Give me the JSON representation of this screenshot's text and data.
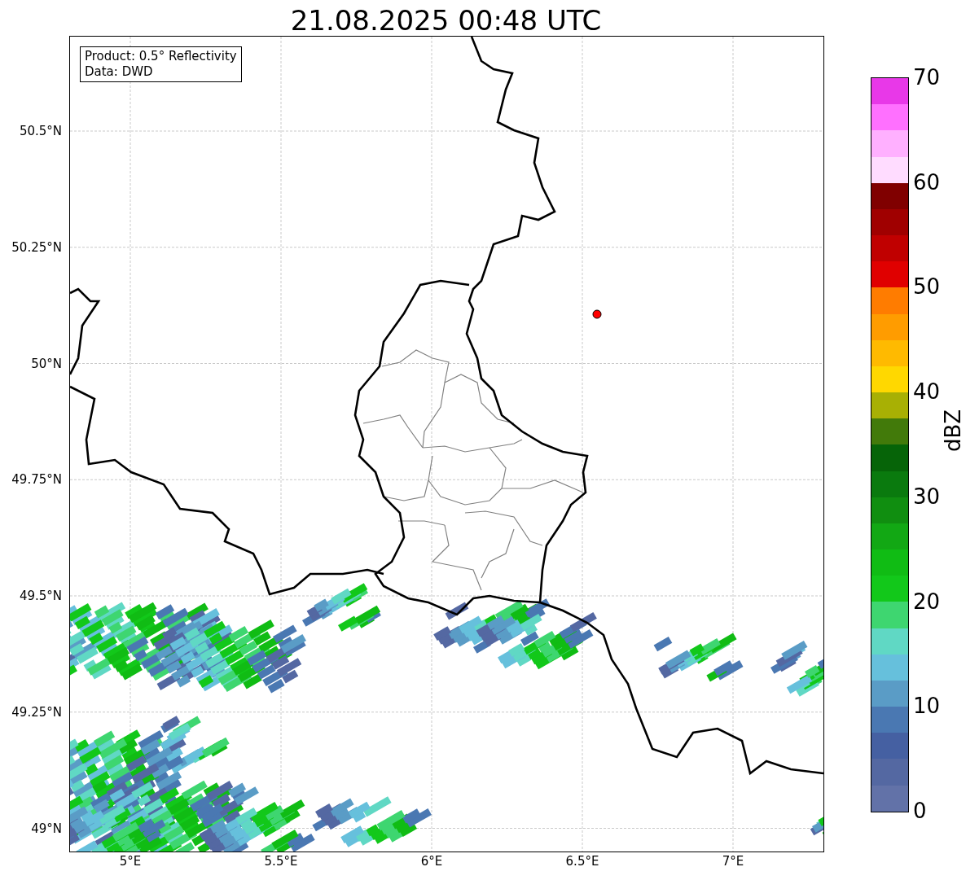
{
  "title": "21.08.2025 00:48 UTC",
  "legend": {
    "lines": [
      "Product: 0.5° Reflectivity",
      "Data: DWD"
    ]
  },
  "x_ticks": [
    "5°E",
    "5.5°E",
    "6°E",
    "6.5°E",
    "7°E"
  ],
  "y_ticks": [
    "50.5°N",
    "50.25°N",
    "50°N",
    "49.75°N",
    "49.5°N",
    "49.25°N",
    "49°N"
  ],
  "colorbar": {
    "label": "dBZ",
    "ticks": [
      "70",
      "60",
      "50",
      "40",
      "30",
      "20",
      "10",
      "0"
    ],
    "bins": [
      {
        "color": "#6272a8"
      },
      {
        "color": "#5468a2"
      },
      {
        "color": "#4560a2"
      },
      {
        "color": "#4a78b2"
      },
      {
        "color": "#5a9cc6"
      },
      {
        "color": "#66c0dc"
      },
      {
        "color": "#60d8c4"
      },
      {
        "color": "#3ed670"
      },
      {
        "color": "#12c81a"
      },
      {
        "color": "#10bc14"
      },
      {
        "color": "#12a814"
      },
      {
        "color": "#108e10"
      },
      {
        "color": "#0a7a0e"
      },
      {
        "color": "#066408"
      },
      {
        "color": "#427a0a"
      },
      {
        "color": "#a8b004"
      },
      {
        "color": "#ffd800"
      },
      {
        "color": "#ffba00"
      },
      {
        "color": "#ff9c00"
      },
      {
        "color": "#ff7c00"
      },
      {
        "color": "#e00000"
      },
      {
        "color": "#c00000"
      },
      {
        "color": "#a00000"
      },
      {
        "color": "#800000"
      },
      {
        "color": "#ffdcff"
      },
      {
        "color": "#ffb0ff"
      },
      {
        "color": "#ff70ff"
      },
      {
        "color": "#e838e8"
      }
    ]
  }
}
